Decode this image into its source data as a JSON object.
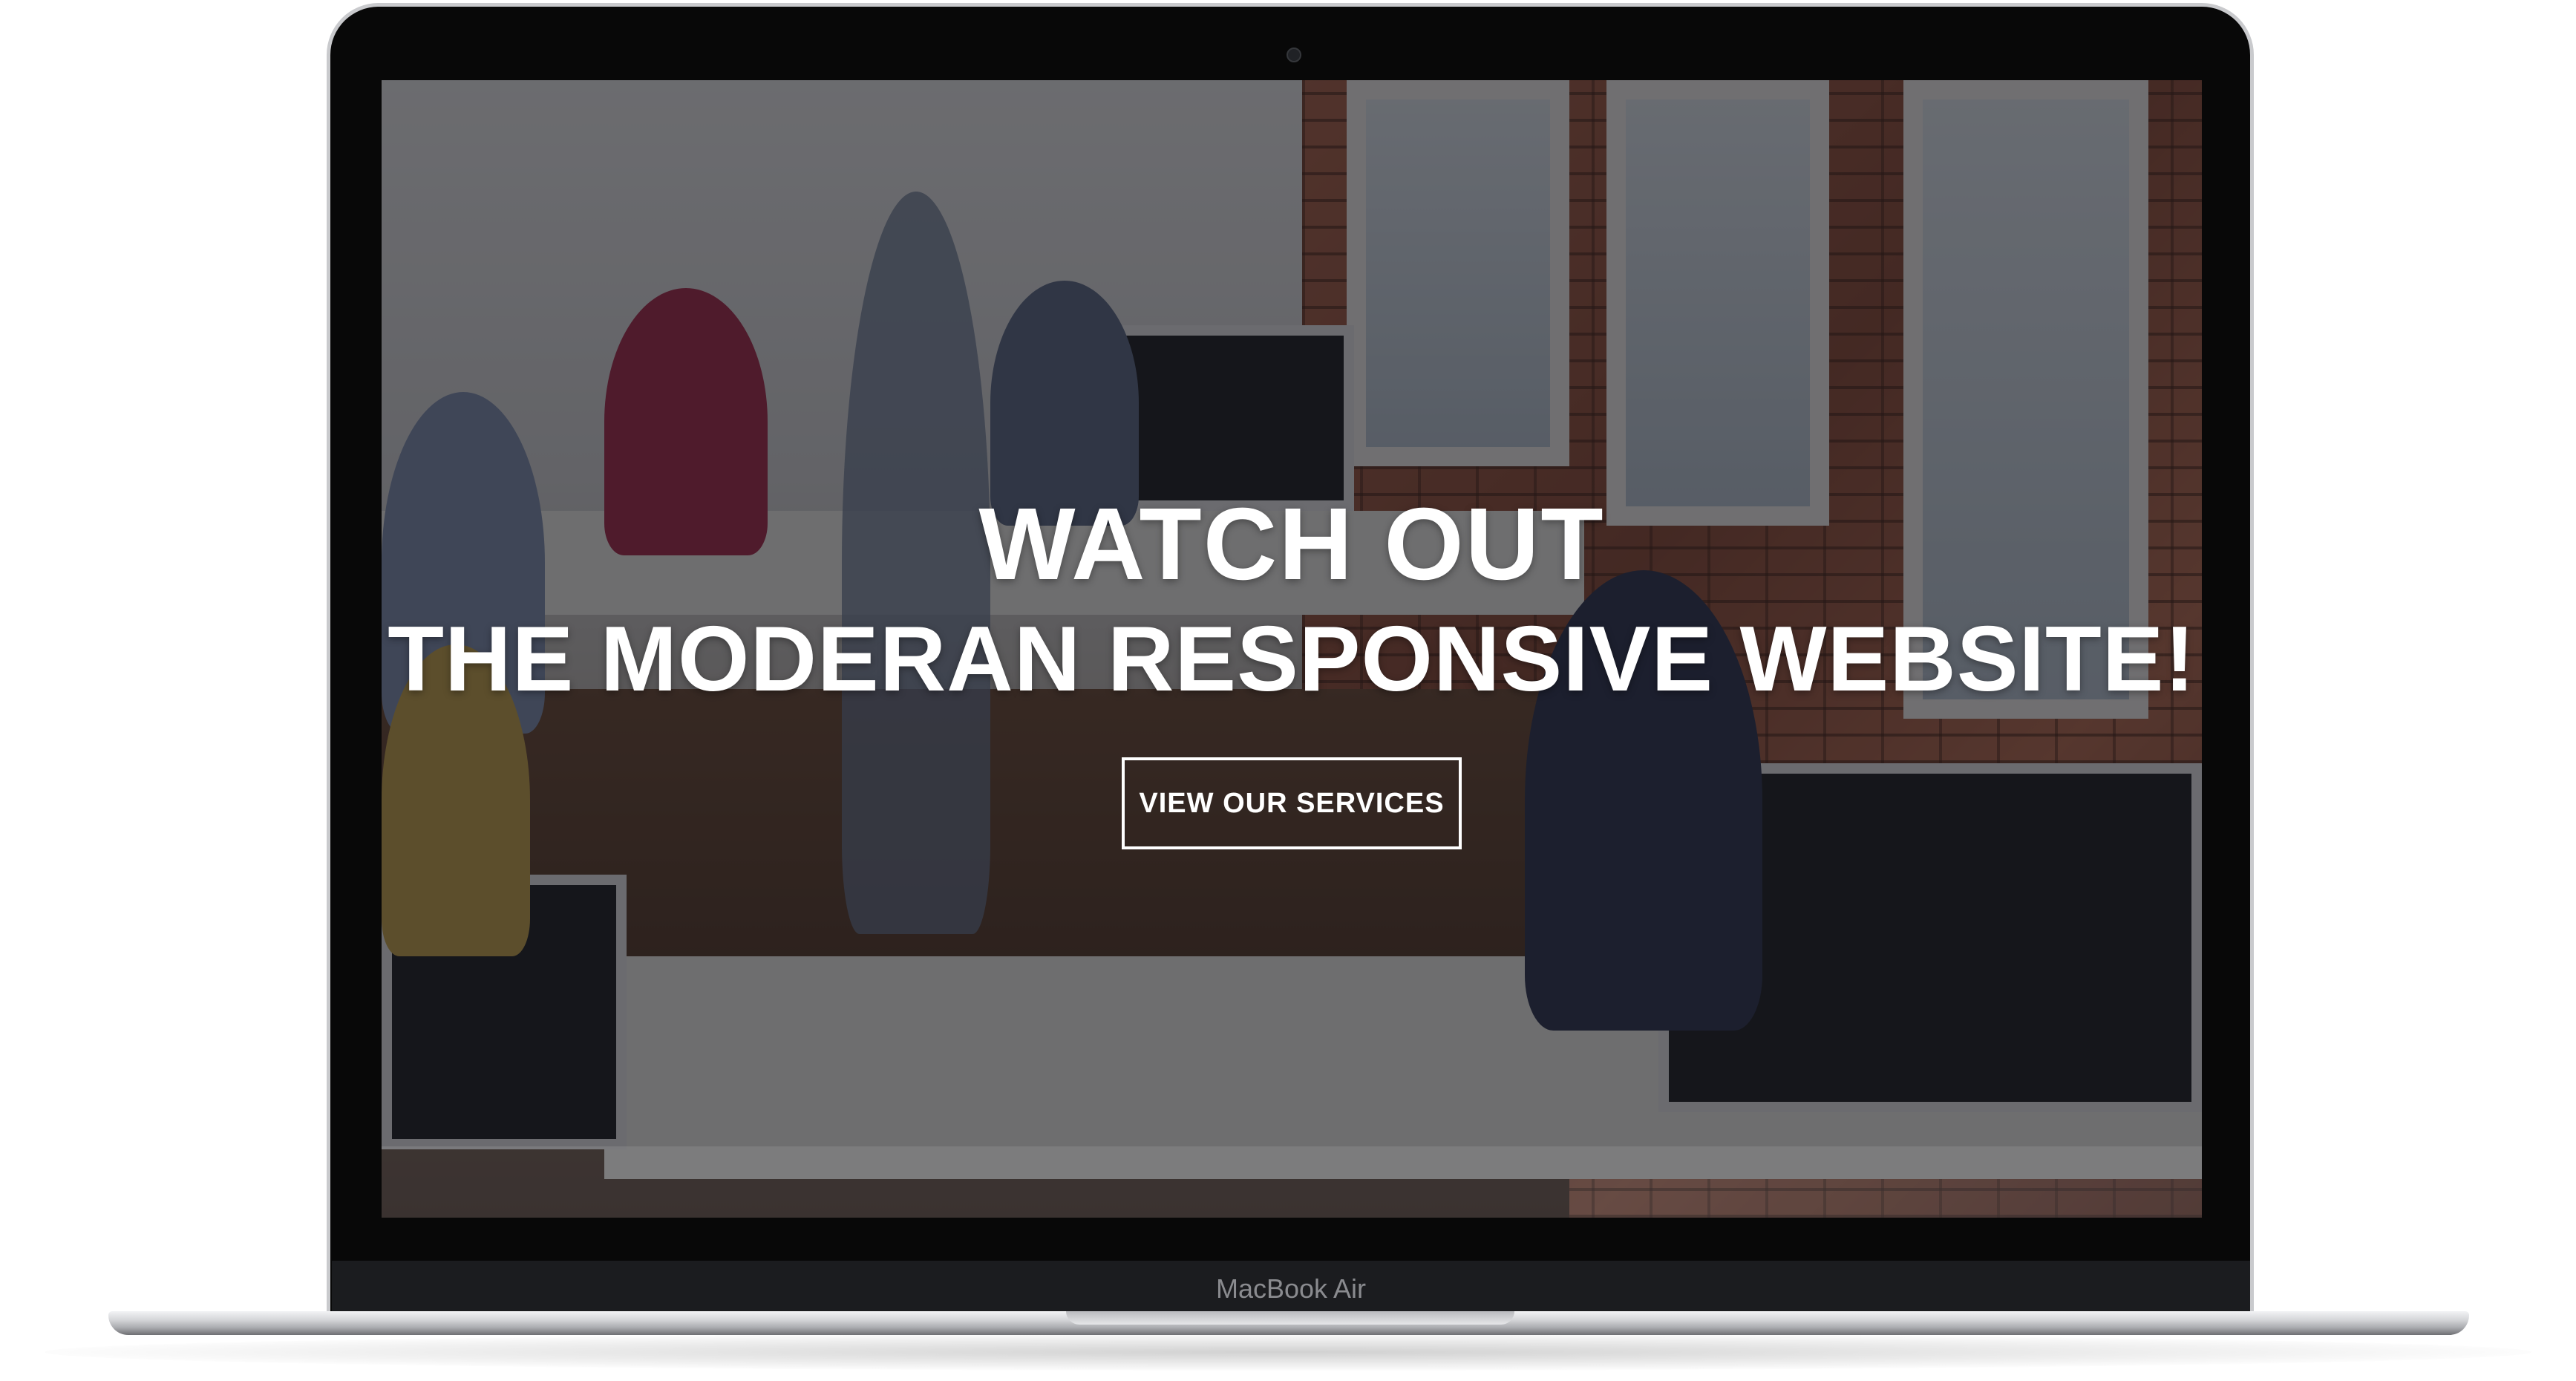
{
  "device": {
    "brand_label": "MacBook Air"
  },
  "hero": {
    "headline_line1": "WATCH OUT",
    "headline_line2": "THE MODERAN RESPONSIVE WEBSITE!",
    "cta_label": "VIEW OUR SERVICES"
  },
  "colors": {
    "overlay": "#121216",
    "text": "#ffffff",
    "bezel": "#080808",
    "brick": "#a9624a"
  }
}
